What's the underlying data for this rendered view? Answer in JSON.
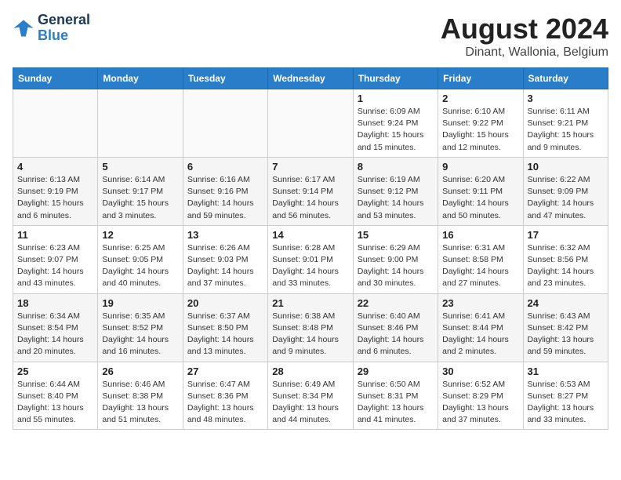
{
  "logo": {
    "line1": "General",
    "line2": "Blue"
  },
  "title": "August 2024",
  "location": "Dinant, Wallonia, Belgium",
  "weekdays": [
    "Sunday",
    "Monday",
    "Tuesday",
    "Wednesday",
    "Thursday",
    "Friday",
    "Saturday"
  ],
  "weeks": [
    [
      {
        "day": "",
        "info": ""
      },
      {
        "day": "",
        "info": ""
      },
      {
        "day": "",
        "info": ""
      },
      {
        "day": "",
        "info": ""
      },
      {
        "day": "1",
        "info": "Sunrise: 6:09 AM\nSunset: 9:24 PM\nDaylight: 15 hours\nand 15 minutes."
      },
      {
        "day": "2",
        "info": "Sunrise: 6:10 AM\nSunset: 9:22 PM\nDaylight: 15 hours\nand 12 minutes."
      },
      {
        "day": "3",
        "info": "Sunrise: 6:11 AM\nSunset: 9:21 PM\nDaylight: 15 hours\nand 9 minutes."
      }
    ],
    [
      {
        "day": "4",
        "info": "Sunrise: 6:13 AM\nSunset: 9:19 PM\nDaylight: 15 hours\nand 6 minutes."
      },
      {
        "day": "5",
        "info": "Sunrise: 6:14 AM\nSunset: 9:17 PM\nDaylight: 15 hours\nand 3 minutes."
      },
      {
        "day": "6",
        "info": "Sunrise: 6:16 AM\nSunset: 9:16 PM\nDaylight: 14 hours\nand 59 minutes."
      },
      {
        "day": "7",
        "info": "Sunrise: 6:17 AM\nSunset: 9:14 PM\nDaylight: 14 hours\nand 56 minutes."
      },
      {
        "day": "8",
        "info": "Sunrise: 6:19 AM\nSunset: 9:12 PM\nDaylight: 14 hours\nand 53 minutes."
      },
      {
        "day": "9",
        "info": "Sunrise: 6:20 AM\nSunset: 9:11 PM\nDaylight: 14 hours\nand 50 minutes."
      },
      {
        "day": "10",
        "info": "Sunrise: 6:22 AM\nSunset: 9:09 PM\nDaylight: 14 hours\nand 47 minutes."
      }
    ],
    [
      {
        "day": "11",
        "info": "Sunrise: 6:23 AM\nSunset: 9:07 PM\nDaylight: 14 hours\nand 43 minutes."
      },
      {
        "day": "12",
        "info": "Sunrise: 6:25 AM\nSunset: 9:05 PM\nDaylight: 14 hours\nand 40 minutes."
      },
      {
        "day": "13",
        "info": "Sunrise: 6:26 AM\nSunset: 9:03 PM\nDaylight: 14 hours\nand 37 minutes."
      },
      {
        "day": "14",
        "info": "Sunrise: 6:28 AM\nSunset: 9:01 PM\nDaylight: 14 hours\nand 33 minutes."
      },
      {
        "day": "15",
        "info": "Sunrise: 6:29 AM\nSunset: 9:00 PM\nDaylight: 14 hours\nand 30 minutes."
      },
      {
        "day": "16",
        "info": "Sunrise: 6:31 AM\nSunset: 8:58 PM\nDaylight: 14 hours\nand 27 minutes."
      },
      {
        "day": "17",
        "info": "Sunrise: 6:32 AM\nSunset: 8:56 PM\nDaylight: 14 hours\nand 23 minutes."
      }
    ],
    [
      {
        "day": "18",
        "info": "Sunrise: 6:34 AM\nSunset: 8:54 PM\nDaylight: 14 hours\nand 20 minutes."
      },
      {
        "day": "19",
        "info": "Sunrise: 6:35 AM\nSunset: 8:52 PM\nDaylight: 14 hours\nand 16 minutes."
      },
      {
        "day": "20",
        "info": "Sunrise: 6:37 AM\nSunset: 8:50 PM\nDaylight: 14 hours\nand 13 minutes."
      },
      {
        "day": "21",
        "info": "Sunrise: 6:38 AM\nSunset: 8:48 PM\nDaylight: 14 hours\nand 9 minutes."
      },
      {
        "day": "22",
        "info": "Sunrise: 6:40 AM\nSunset: 8:46 PM\nDaylight: 14 hours\nand 6 minutes."
      },
      {
        "day": "23",
        "info": "Sunrise: 6:41 AM\nSunset: 8:44 PM\nDaylight: 14 hours\nand 2 minutes."
      },
      {
        "day": "24",
        "info": "Sunrise: 6:43 AM\nSunset: 8:42 PM\nDaylight: 13 hours\nand 59 minutes."
      }
    ],
    [
      {
        "day": "25",
        "info": "Sunrise: 6:44 AM\nSunset: 8:40 PM\nDaylight: 13 hours\nand 55 minutes."
      },
      {
        "day": "26",
        "info": "Sunrise: 6:46 AM\nSunset: 8:38 PM\nDaylight: 13 hours\nand 51 minutes."
      },
      {
        "day": "27",
        "info": "Sunrise: 6:47 AM\nSunset: 8:36 PM\nDaylight: 13 hours\nand 48 minutes."
      },
      {
        "day": "28",
        "info": "Sunrise: 6:49 AM\nSunset: 8:34 PM\nDaylight: 13 hours\nand 44 minutes."
      },
      {
        "day": "29",
        "info": "Sunrise: 6:50 AM\nSunset: 8:31 PM\nDaylight: 13 hours\nand 41 minutes."
      },
      {
        "day": "30",
        "info": "Sunrise: 6:52 AM\nSunset: 8:29 PM\nDaylight: 13 hours\nand 37 minutes."
      },
      {
        "day": "31",
        "info": "Sunrise: 6:53 AM\nSunset: 8:27 PM\nDaylight: 13 hours\nand 33 minutes."
      }
    ]
  ]
}
